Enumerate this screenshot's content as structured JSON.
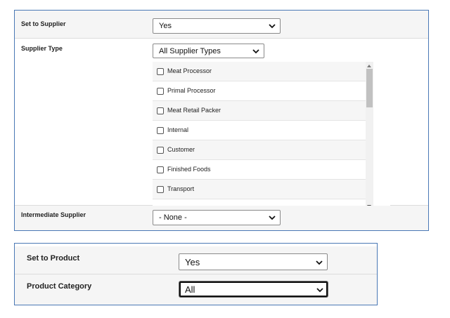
{
  "supplier_panel": {
    "set_to_supplier": {
      "label": "Set to Supplier",
      "value": "Yes"
    },
    "supplier_type": {
      "label": "Supplier Type",
      "value": "All Supplier Types",
      "items": [
        "Meat Processor",
        "Primal Processor",
        "Meat Retail Packer",
        "Internal",
        "Customer",
        "Finished Foods",
        "Transport"
      ]
    },
    "intermediate_supplier": {
      "label": "Intermediate Supplier",
      "value": "- None -"
    }
  },
  "product_panel": {
    "set_to_product": {
      "label": "Set to Product",
      "value": "Yes"
    },
    "product_category": {
      "label": "Product Category",
      "value": "All"
    }
  },
  "colors": {
    "panel_border": "#4a78b5",
    "row_shade": "#f5f5f5"
  },
  "icons": {
    "dropdown": "chevron-down-icon",
    "checkbox": "checkbox-icon"
  }
}
